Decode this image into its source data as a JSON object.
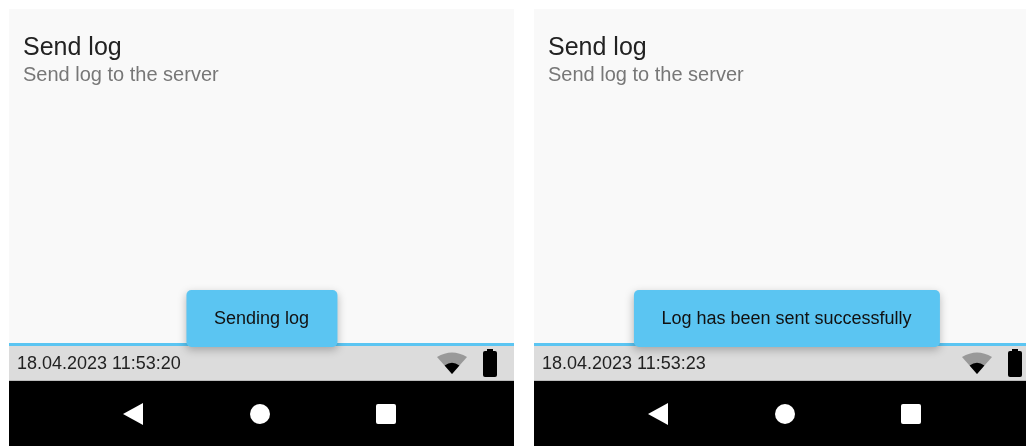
{
  "screens": [
    {
      "title": "Send log",
      "subtitle": "Send log to the server",
      "toast": "Sending log",
      "status_time": "18.04.2023 11:53:20"
    },
    {
      "title": "Send log",
      "subtitle": "Send log to the server",
      "toast": "Log has been sent successfully",
      "status_time": "18.04.2023 11:53:23"
    }
  ]
}
